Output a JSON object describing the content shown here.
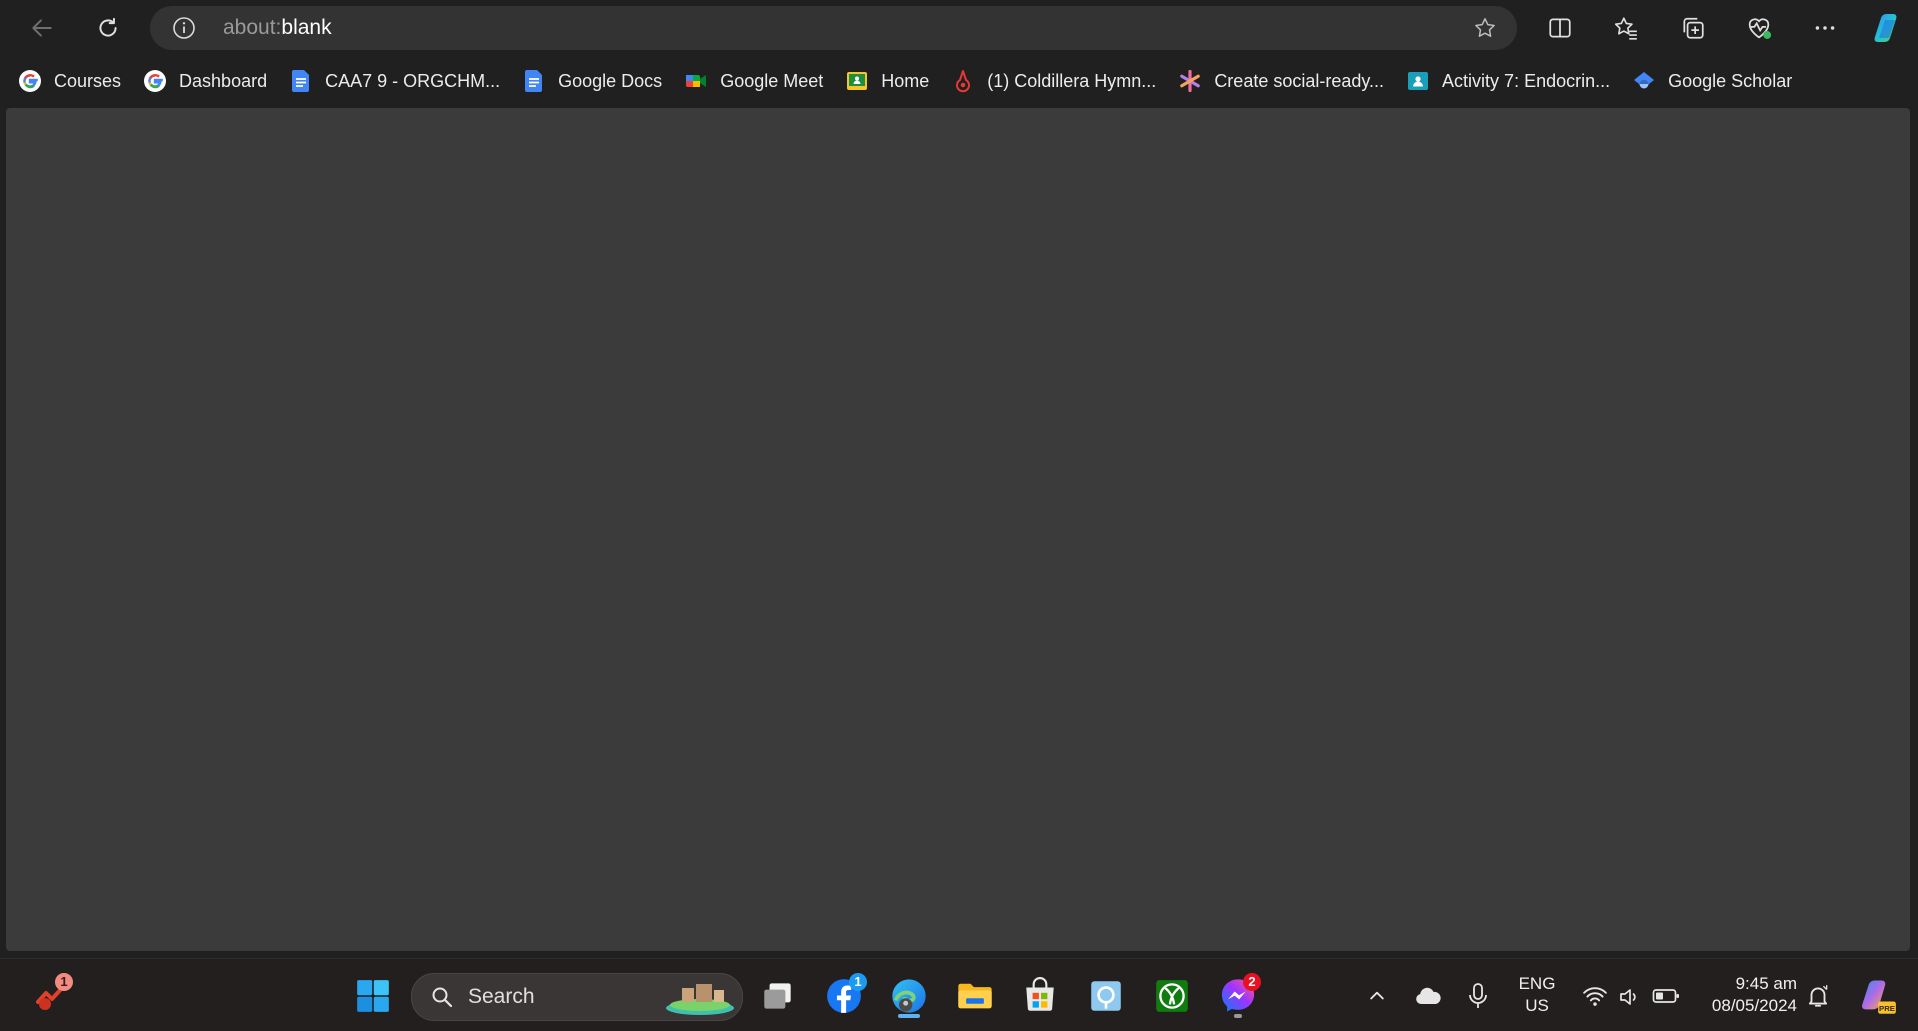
{
  "browser": {
    "address": {
      "scheme": "about:",
      "host": "blank"
    },
    "bookmarks": [
      {
        "label": "Courses",
        "icon": "google-icon"
      },
      {
        "label": "Dashboard",
        "icon": "google-icon"
      },
      {
        "label": "CAA7 9 - ORGCHM...",
        "icon": "google-docs-icon"
      },
      {
        "label": "Google Docs",
        "icon": "google-docs-icon"
      },
      {
        "label": "Google Meet",
        "icon": "google-meet-icon"
      },
      {
        "label": "Home",
        "icon": "google-classroom-icon"
      },
      {
        "label": "(1) Coldillera Hymn...",
        "icon": "music-app-icon"
      },
      {
        "label": "Create social-ready...",
        "icon": "asterisk-icon"
      },
      {
        "label": "Activity 7: Endocrin...",
        "icon": "classroom-assignment-icon"
      },
      {
        "label": "Google Scholar",
        "icon": "google-scholar-icon"
      }
    ]
  },
  "taskbar": {
    "search_label": "Search",
    "widget_badge": "1",
    "facebook_badge": "1",
    "messenger_badge": "2",
    "language": {
      "line1": "ENG",
      "line2": "US"
    },
    "clock": {
      "time": "9:45 am",
      "date": "08/05/2024"
    }
  },
  "colors": {
    "page_bg": "#3b3b3b",
    "chrome_bg": "#202020",
    "taskbar_bg": "#231f1f",
    "accent": "#5fb2f2",
    "badge_red": "#e81123"
  }
}
